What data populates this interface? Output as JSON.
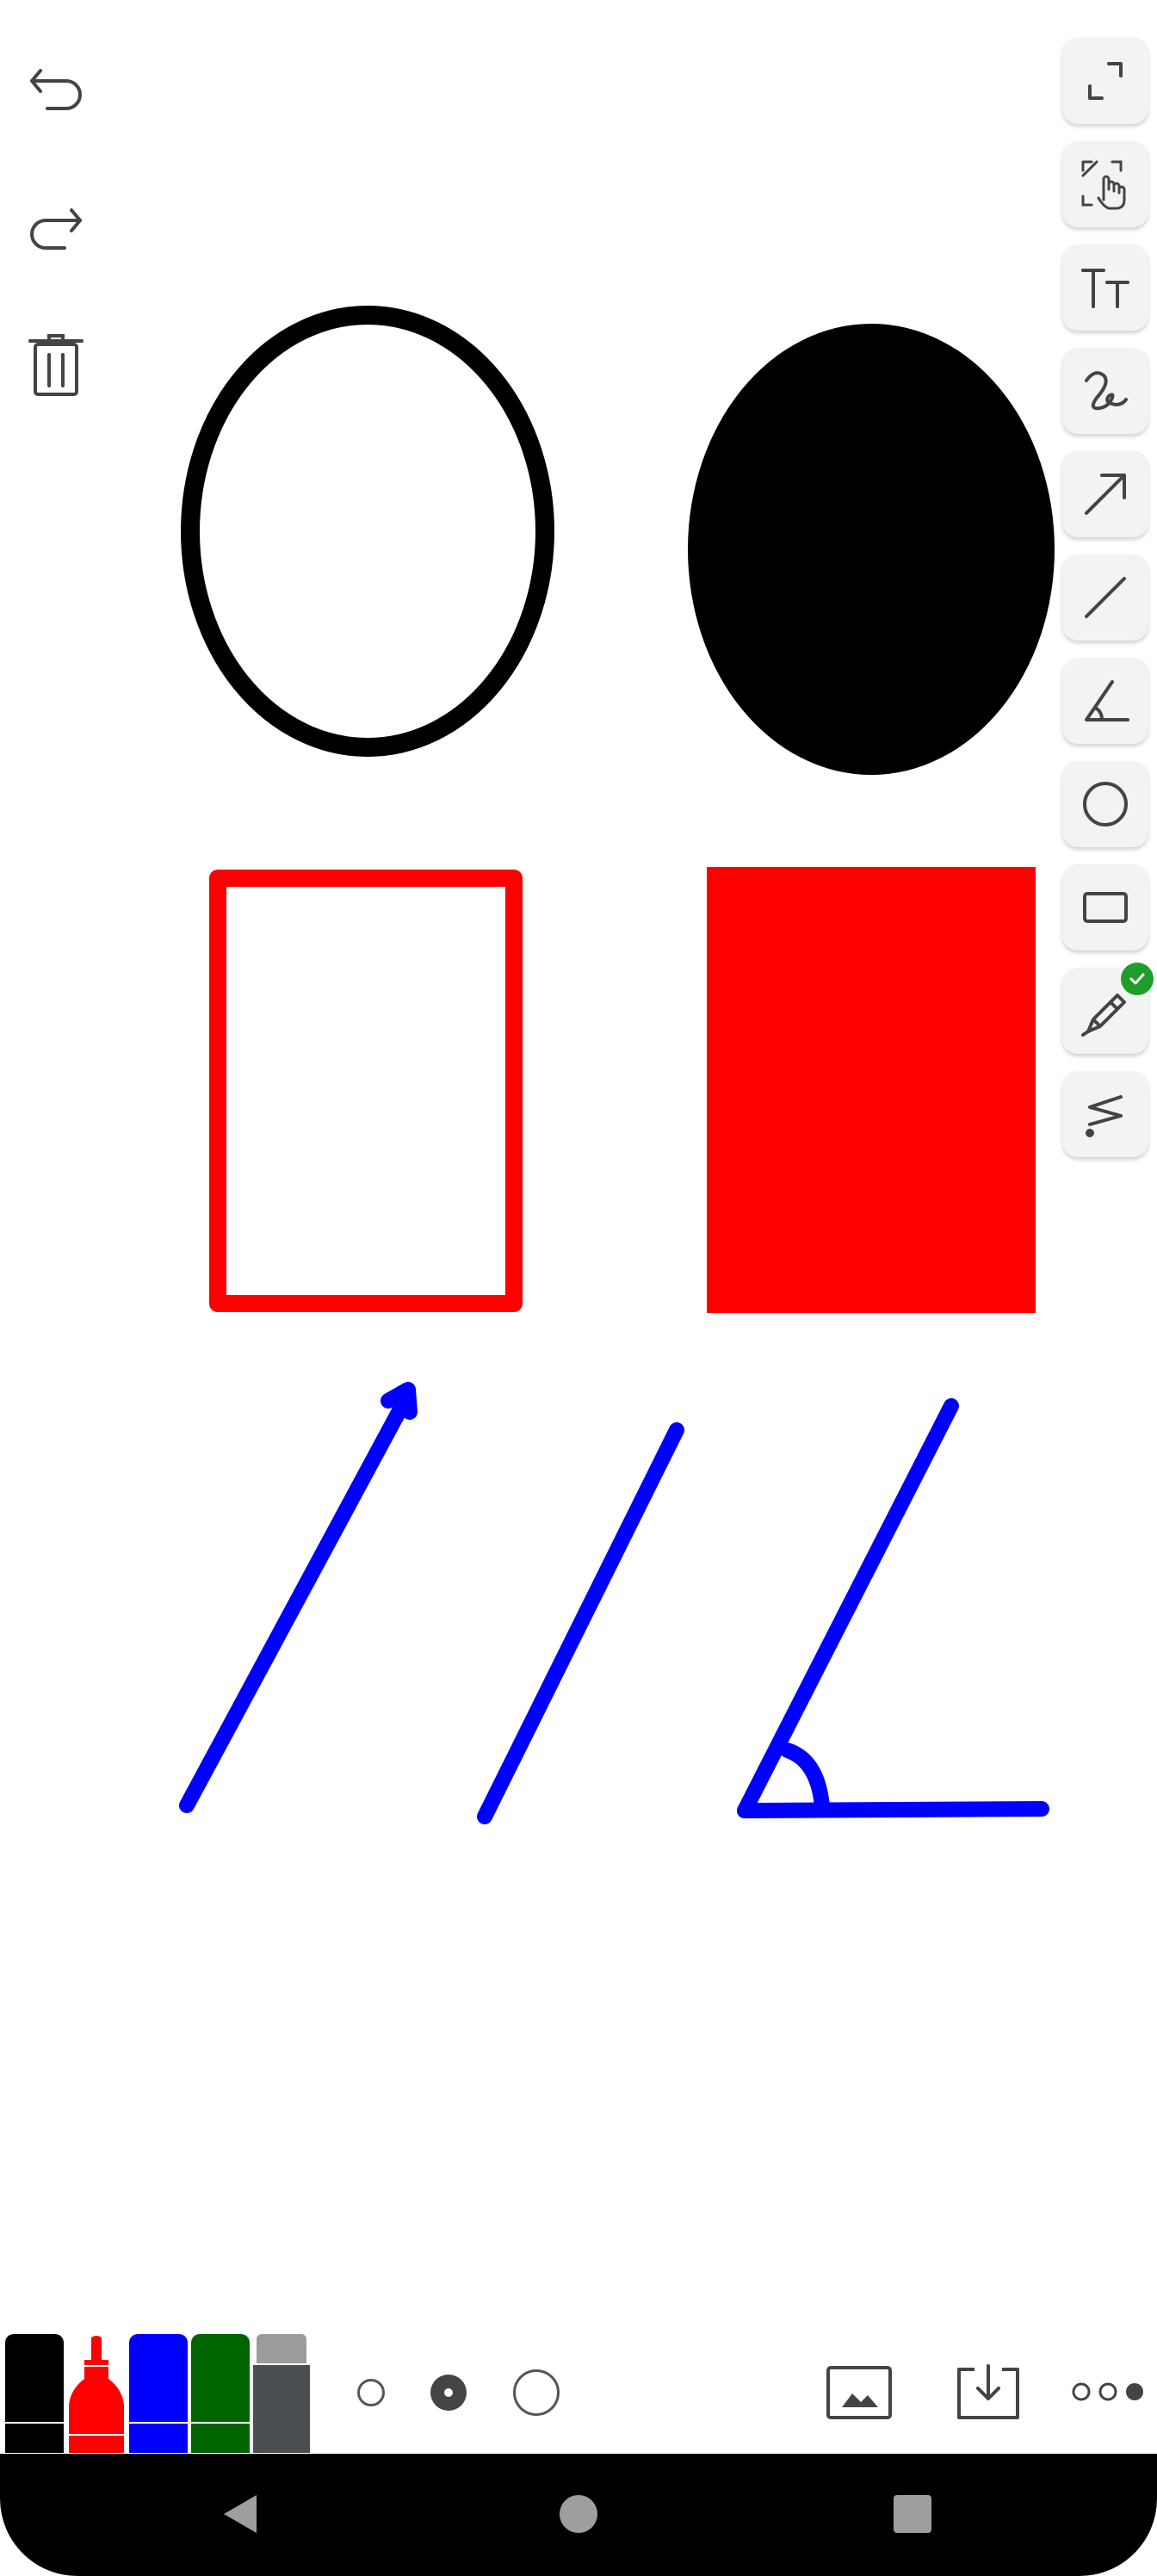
{
  "app": {
    "background": "#ffffff"
  },
  "history": {
    "undo_icon": "undo-icon",
    "redo_icon": "redo-icon",
    "clear_icon": "trash-icon"
  },
  "tools": [
    {
      "name": "fullscreen",
      "icon": "expand-icon"
    },
    {
      "name": "pan-zoom",
      "icon": "pan-hand-icon"
    },
    {
      "name": "text",
      "icon": "text-size-icon"
    },
    {
      "name": "freehand",
      "icon": "squiggle-icon"
    },
    {
      "name": "arrow",
      "icon": "arrow-icon"
    },
    {
      "name": "line",
      "icon": "line-icon"
    },
    {
      "name": "angle",
      "icon": "angle-icon"
    },
    {
      "name": "circle",
      "icon": "circle-icon"
    },
    {
      "name": "rectangle",
      "icon": "rectangle-icon"
    },
    {
      "name": "marker",
      "icon": "marker-icon",
      "selected": true
    },
    {
      "name": "eraser",
      "icon": "eraser-icon"
    }
  ],
  "colors": {
    "black": "#000000",
    "red": "#ff0000",
    "blue": "#0000ff",
    "green": "#006400",
    "eraser": "#4a4f52",
    "selected_badge": "#1f9d2b"
  },
  "palette": [
    {
      "name": "black",
      "color": "#000000"
    },
    {
      "name": "red",
      "color": "#ff0000"
    },
    {
      "name": "blue",
      "color": "#0000ff"
    },
    {
      "name": "green",
      "color": "#006400"
    },
    {
      "name": "eraser",
      "color": "#4a4f52"
    }
  ],
  "stroke_sizes": [
    "small",
    "medium",
    "large"
  ],
  "selected_stroke_size": "medium",
  "bottom_actions": [
    {
      "name": "insert-image",
      "icon": "image-icon"
    },
    {
      "name": "save",
      "icon": "download-icon"
    },
    {
      "name": "more",
      "icon": "more-icon"
    }
  ],
  "system_nav": {
    "back_icon": "back-icon",
    "home_icon": "home-icon",
    "recents_icon": "recents-icon"
  }
}
